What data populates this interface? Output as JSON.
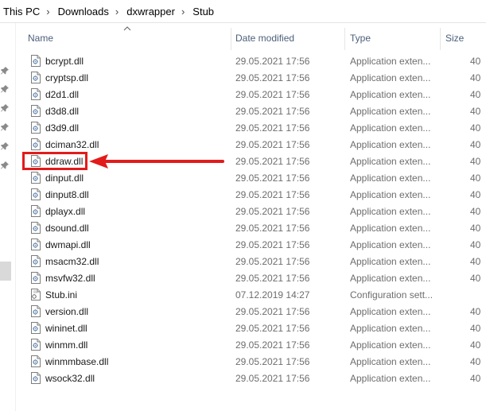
{
  "breadcrumb": [
    {
      "label": "This PC"
    },
    {
      "label": "Downloads"
    },
    {
      "label": "dxwrapper"
    },
    {
      "label": "Stub"
    }
  ],
  "columns": {
    "name": "Name",
    "date": "Date modified",
    "type": "Type",
    "size": "Size"
  },
  "files": [
    {
      "name": "bcrypt.dll",
      "date": "29.05.2021 17:56",
      "type": "Application exten...",
      "size": "40"
    },
    {
      "name": "cryptsp.dll",
      "date": "29.05.2021 17:56",
      "type": "Application exten...",
      "size": "40"
    },
    {
      "name": "d2d1.dll",
      "date": "29.05.2021 17:56",
      "type": "Application exten...",
      "size": "40"
    },
    {
      "name": "d3d8.dll",
      "date": "29.05.2021 17:56",
      "type": "Application exten...",
      "size": "40"
    },
    {
      "name": "d3d9.dll",
      "date": "29.05.2021 17:56",
      "type": "Application exten...",
      "size": "40"
    },
    {
      "name": "dciman32.dll",
      "date": "29.05.2021 17:56",
      "type": "Application exten...",
      "size": "40"
    },
    {
      "name": "ddraw.dll",
      "date": "29.05.2021 17:56",
      "type": "Application exten...",
      "size": "40"
    },
    {
      "name": "dinput.dll",
      "date": "29.05.2021 17:56",
      "type": "Application exten...",
      "size": "40"
    },
    {
      "name": "dinput8.dll",
      "date": "29.05.2021 17:56",
      "type": "Application exten...",
      "size": "40"
    },
    {
      "name": "dplayx.dll",
      "date": "29.05.2021 17:56",
      "type": "Application exten...",
      "size": "40"
    },
    {
      "name": "dsound.dll",
      "date": "29.05.2021 17:56",
      "type": "Application exten...",
      "size": "40"
    },
    {
      "name": "dwmapi.dll",
      "date": "29.05.2021 17:56",
      "type": "Application exten...",
      "size": "40"
    },
    {
      "name": "msacm32.dll",
      "date": "29.05.2021 17:56",
      "type": "Application exten...",
      "size": "40"
    },
    {
      "name": "msvfw32.dll",
      "date": "29.05.2021 17:56",
      "type": "Application exten...",
      "size": "40"
    },
    {
      "name": "Stub.ini",
      "date": "07.12.2019 14:27",
      "type": "Configuration sett...",
      "size": ""
    },
    {
      "name": "version.dll",
      "date": "29.05.2021 17:56",
      "type": "Application exten...",
      "size": "40"
    },
    {
      "name": "wininet.dll",
      "date": "29.05.2021 17:56",
      "type": "Application exten...",
      "size": "40"
    },
    {
      "name": "winmm.dll",
      "date": "29.05.2021 17:56",
      "type": "Application exten...",
      "size": "40"
    },
    {
      "name": "winmmbase.dll",
      "date": "29.05.2021 17:56",
      "type": "Application exten...",
      "size": "40"
    },
    {
      "name": "wsock32.dll",
      "date": "29.05.2021 17:56",
      "type": "Application exten...",
      "size": "40"
    }
  ],
  "icons": {
    "dll": "dll-file-icon",
    "ini": "ini-file-icon",
    "pin": "pin-icon",
    "sort": "sort-ascending-icon"
  },
  "colors": {
    "highlight": "#e21b1b",
    "header_text": "#4c607a",
    "meta_text": "#6d6d6d"
  }
}
